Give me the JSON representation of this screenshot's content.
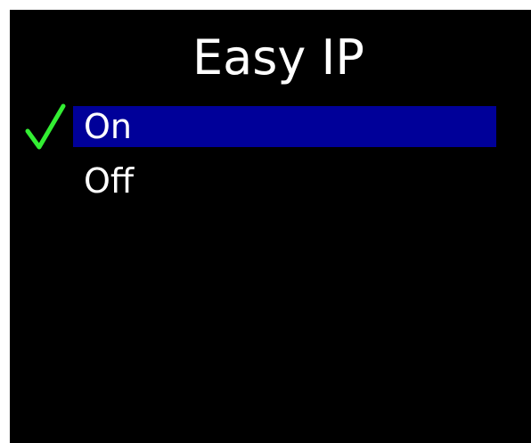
{
  "screen": {
    "title": "Easy IP",
    "menu": {
      "items": [
        {
          "label": "On",
          "selected": true,
          "checked": true
        },
        {
          "label": "Off",
          "selected": false,
          "checked": false
        }
      ]
    }
  },
  "colors": {
    "background": "#000000",
    "text": "#ffffff",
    "highlight": "#000099",
    "check": "#33ee33"
  },
  "icons": {
    "check": "checkmark-icon"
  }
}
